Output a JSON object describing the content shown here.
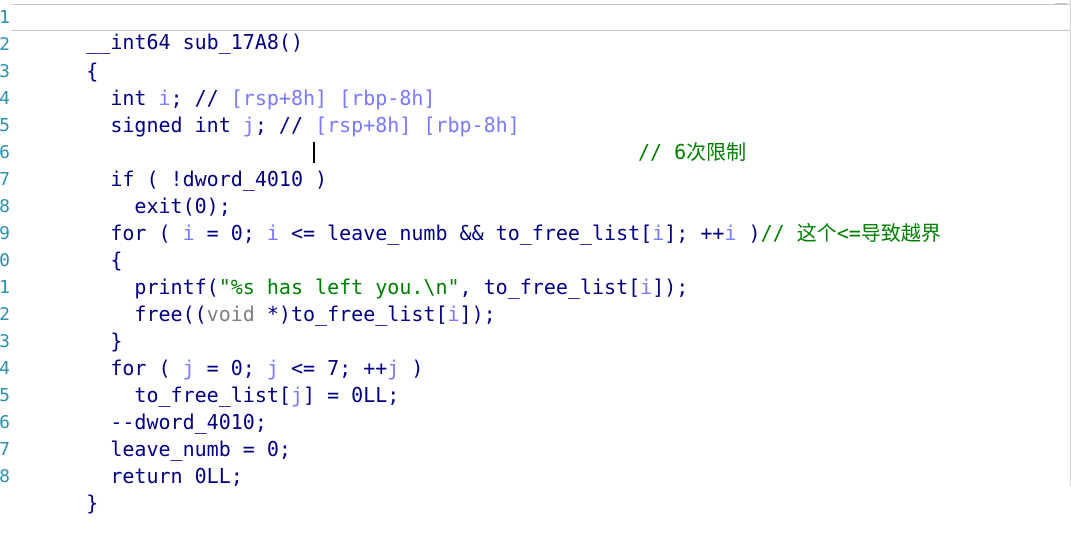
{
  "gutter": {
    "numbers": [
      "1",
      "2",
      "3",
      "4",
      "5",
      "6",
      "7",
      "8",
      "9",
      "0",
      "1",
      "2",
      "3",
      "4",
      "5",
      "6",
      "7",
      "8"
    ]
  },
  "code": {
    "line1": {
      "t1": "__int64 sub_17A8()"
    },
    "line2": {
      "t1": "{"
    },
    "line3": {
      "t1": "  int ",
      "t2": "i",
      "t3": "; // ",
      "t4": "[rsp+8h] [rbp-8h]"
    },
    "line4": {
      "t1": "  signed int ",
      "t2": "j",
      "t3": "; // ",
      "t4": "[rsp+8h] [rbp-8h]"
    },
    "line5": {
      "t1": ""
    },
    "line6": {
      "t1": "  if ( !dword_4010 )",
      "t2": "// 6次限制"
    },
    "line7": {
      "t1": "    exit(0);"
    },
    "line8": {
      "t1": "  for ( ",
      "t2": "i",
      "t3": " = 0; ",
      "t4": "i",
      "t5": " <= leave_numb && to_free_list[",
      "t6": "i",
      "t7": "]; ++",
      "t8": "i",
      "t9": " )",
      "t10": "// 这个<=导致越界"
    },
    "line9": {
      "t1": "  {"
    },
    "line10": {
      "t1": "    printf(",
      "t2": "\"%s has left you.\\n\"",
      "t3": ", to_free_list[",
      "t4": "i",
      "t5": "]);"
    },
    "line11": {
      "t1": "    free((",
      "t2": "void",
      "t3": " *)to_free_list[",
      "t4": "i",
      "t5": "]);"
    },
    "line12": {
      "t1": "  }"
    },
    "line13": {
      "t1": "  for ( ",
      "t2": "j",
      "t3": " = 0; ",
      "t4": "j",
      "t5": " <= 7; ++",
      "t6": "j",
      "t7": " )"
    },
    "line14": {
      "t1": "    to_free_list[",
      "t2": "j",
      "t3": "] = 0LL;"
    },
    "line15": {
      "t1": "  --dword_4010;"
    },
    "line16": {
      "t1": "  leave_numb = 0;"
    },
    "line17": {
      "t1": "  return 0LL;"
    },
    "line18": {
      "t1": "}"
    }
  }
}
